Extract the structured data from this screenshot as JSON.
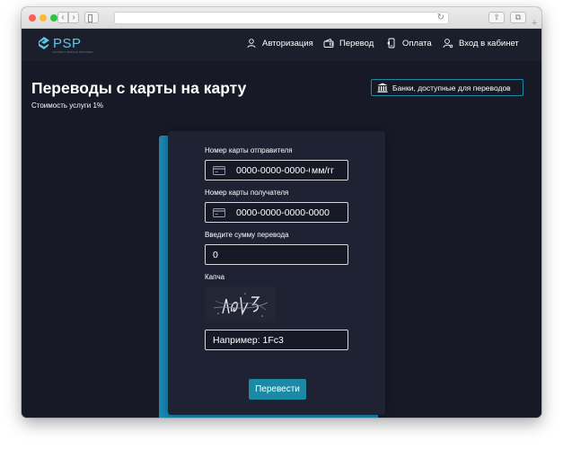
{
  "browser": {
    "buttons": {
      "back": "‹",
      "forward": "›",
      "reload": "↻",
      "share": "⇧",
      "tabs": "⧉",
      "new_tab": "+"
    }
  },
  "header": {
    "logo_text": "PSP",
    "logo_subtext": "PAYMENT SERVICE PROVIDER",
    "nav": {
      "auth": "Авторизация",
      "transfer": "Перевод",
      "payment": "Оплата",
      "cabinet": "Вход в кабинет"
    }
  },
  "page": {
    "title": "Переводы с карты на карту",
    "subtitle": "Стоимость услуги 1%",
    "banks_button": "Банки, доступные для переводов"
  },
  "form": {
    "sender_label": "Номер карты отправителя",
    "sender_value": "0000-0000-0000-0000",
    "sender_expiry": "мм/гг",
    "receiver_label": "Номер карты получателя",
    "receiver_value": "0000-0000-0000-0000",
    "amount_label": "Введите сумму перевода",
    "amount_value": "0",
    "captcha_label": "Капча",
    "captcha_placeholder": "Например: 1Fc3",
    "submit_label": "Перевести"
  },
  "colors": {
    "background": "#171a26",
    "header": "#1b1f2c",
    "card": "#1f2233",
    "accent": "#1c8aa5",
    "logo": "#5ec8e8"
  },
  "icons": {
    "logo": "psp-logo-icon",
    "auth": "user-icon",
    "transfer": "wallet-icon",
    "payment": "payment-icon",
    "cabinet": "user-key-icon",
    "banks": "bank-icon",
    "card": "credit-card-icon"
  }
}
